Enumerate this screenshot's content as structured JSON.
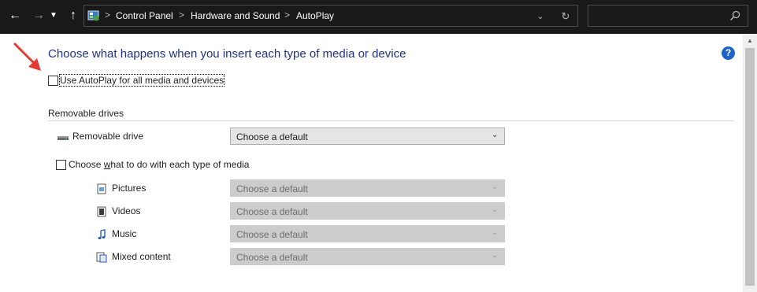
{
  "toolbar": {
    "back_icon": "arrow-left-icon",
    "forward_icon": "arrow-right-icon",
    "recent_icon": "chevron-down-icon",
    "up_icon": "arrow-up-icon"
  },
  "address": {
    "icon": "control-panel-icon",
    "crumbs": [
      "Control Panel",
      "Hardware and Sound",
      "AutoPlay"
    ],
    "separator": ">",
    "dropdown_icon": "chevron-down-icon",
    "refresh_icon": "refresh-icon"
  },
  "search": {
    "value": "",
    "icon": "search-icon"
  },
  "page": {
    "heading": "Choose what happens when you insert each type of media or device",
    "help_glyph": "?",
    "use_autoplay_label": "Use AutoPlay for all media and devices",
    "use_autoplay_checked": false,
    "section_title": "Removable drives",
    "removable_drive": {
      "label": "Removable drive",
      "value": "Choose a default",
      "icon": "removable-drive-icon"
    },
    "media_choice_label_pre": "Choose ",
    "media_choice_label_key": "w",
    "media_choice_label_post": "hat to do with each type of media",
    "media_choice_checked": false,
    "media_types": [
      {
        "label": "Pictures",
        "value": "Choose a default",
        "icon": "pictures-icon"
      },
      {
        "label": "Videos",
        "value": "Choose a default",
        "icon": "videos-icon"
      },
      {
        "label": "Music",
        "value": "Choose a default",
        "icon": "music-icon"
      },
      {
        "label": "Mixed content",
        "value": "Choose a default",
        "icon": "mixed-content-icon"
      }
    ]
  },
  "colors": {
    "titlebar_bg": "#191919",
    "heading": "#1e3287",
    "help_badge": "#1e64c8",
    "annotation_arrow": "#e03c31"
  }
}
